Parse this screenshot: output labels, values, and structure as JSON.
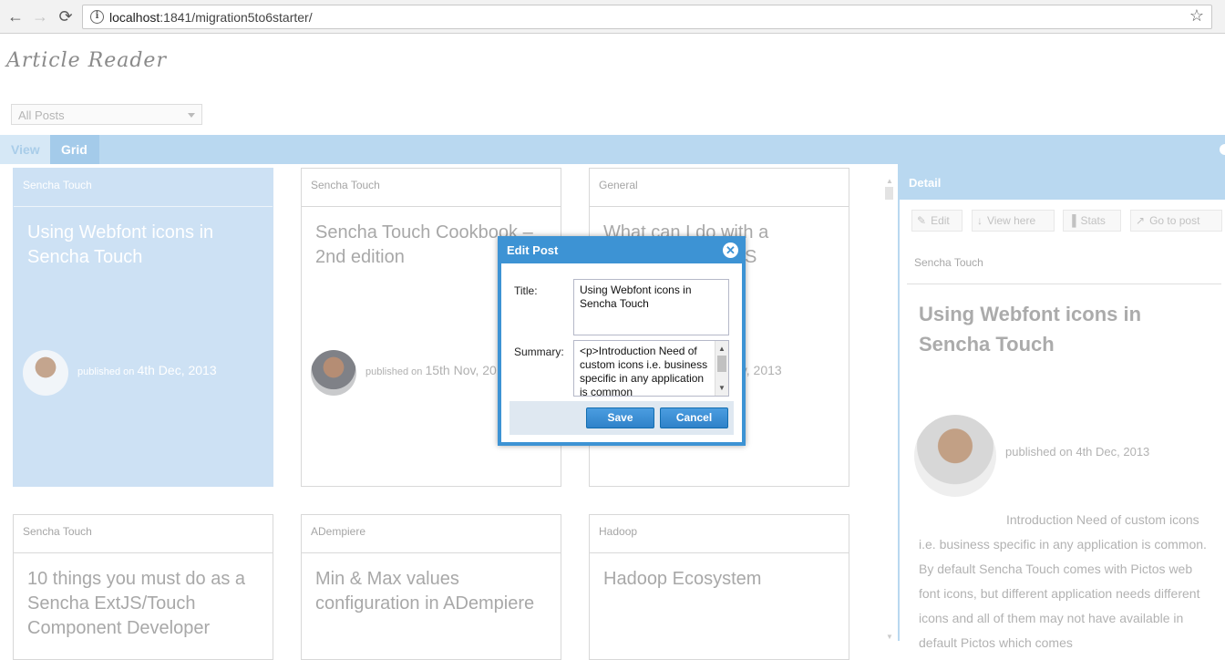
{
  "browser": {
    "back_icon": "←",
    "forward_icon": "→",
    "reload_icon": "⟳",
    "info_icon": "i",
    "url_host": "localhost",
    "url_rest": ":1841/migration5to6starter/",
    "star_icon": "☆"
  },
  "app": {
    "title": "Article Reader",
    "filter_select_value": "All Posts",
    "tabs": [
      {
        "label": "View"
      },
      {
        "label": "Grid"
      }
    ]
  },
  "cards": [
    {
      "category": "Sencha Touch",
      "title": "Using Webfont icons in Sencha Touch",
      "published_prefix": "published on",
      "date": "4th Dec, 2013"
    },
    {
      "category": "Sencha Touch",
      "title": "Sencha Touch Cookbook – 2nd edition",
      "published_prefix": "published on",
      "date": "15th Nov, 20"
    },
    {
      "category": "General",
      "title": "What can I do with a",
      "title_tail": "S",
      "date": "ov, 2013"
    },
    {
      "category": "Sencha Touch",
      "title": "10 things you must do as a Sencha ExtJS/Touch Component Developer"
    },
    {
      "category": "ADempiere",
      "title": "Min & Max values configuration in ADempiere"
    },
    {
      "category": "Hadoop",
      "title": "Hadoop Ecosystem"
    }
  ],
  "detail": {
    "header": "Detail",
    "buttons": [
      {
        "icon": "✎",
        "label": "Edit"
      },
      {
        "icon": "↓",
        "label": "View here"
      },
      {
        "icon": "▐",
        "label": "Stats"
      },
      {
        "icon": "↗",
        "label": "Go to post"
      }
    ],
    "category": "Sencha Touch",
    "title": "Using Webfont icons in Sencha Touch",
    "published": "published on 4th Dec, 2013",
    "summary": "Introduction Need of custom icons i.e. business specific in any application is common. By default Sencha Touch comes with Pictos web font icons, but different application needs different icons and all of them may not have available in default Pictos which comes"
  },
  "modal": {
    "title": "Edit Post",
    "close_icon": "✕",
    "title_label": "Title:",
    "title_value": "Using Webfont icons in Sencha Touch",
    "summary_label": "Summary:",
    "summary_value": "<p>Introduction Need of custom icons i.e. business specific in any application is common",
    "save_label": "Save",
    "cancel_label": "Cancel"
  },
  "colors": {
    "accent": "#3d93d4",
    "tabbar": "#b9d8f0",
    "selected_card": "#cde1f4"
  }
}
